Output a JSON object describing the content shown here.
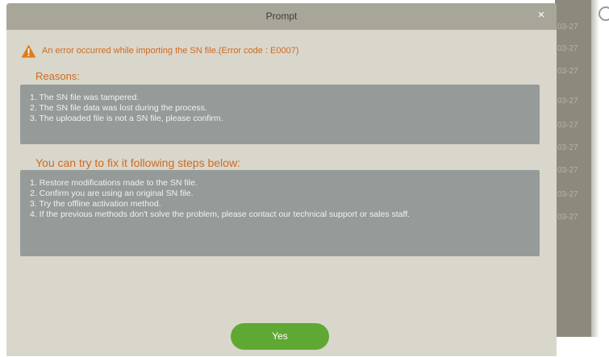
{
  "dialog": {
    "title": "Prompt",
    "close_label": "×",
    "error_message": "An error occurred while importing the SN file.(Error code : E0007)",
    "reasons_title": "Reasons:",
    "reasons": [
      "1. The SN file was tampered.",
      "2. The SN file data was lost during the process.",
      "3. The uploaded file is not a SN file, please confirm."
    ],
    "steps_title": "You can try to fix it following steps below:",
    "steps": [
      "1. Restore modifications made to the SN file.",
      "2. Confirm you are using an original SN file.",
      "3. Try the offline activation method.",
      "4. If the previous methods don't solve the problem, please contact our technical support or sales staff."
    ],
    "yes_label": "Yes"
  },
  "background": {
    "dates": [
      "03-27",
      "03-27",
      "03-27",
      "03-27",
      "03-27",
      "03-27",
      "03-27",
      "03-27",
      "03-27"
    ]
  },
  "colors": {
    "accent_orange": "#d2691e",
    "button_green": "#5fa833",
    "info_box": "#949b98",
    "warning_icon": "#e07b1a"
  },
  "icons": {
    "warning": "warning-triangle-icon",
    "close": "close-icon"
  }
}
